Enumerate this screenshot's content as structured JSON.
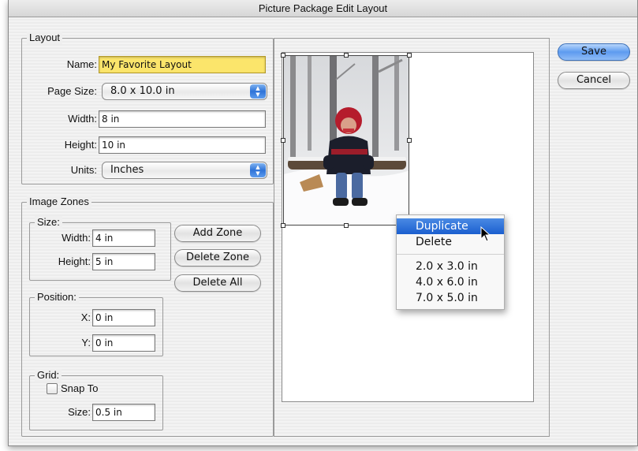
{
  "window": {
    "title": "Picture Package Edit Layout"
  },
  "layout": {
    "legend": "Layout",
    "name_label": "Name:",
    "name_value": "My Favorite Layout",
    "page_size_label": "Page Size:",
    "page_size_value": "8.0 x 10.0 in",
    "width_label": "Width:",
    "width_value": "8 in",
    "height_label": "Height:",
    "height_value": "10 in",
    "units_label": "Units:",
    "units_value": "Inches"
  },
  "image_zones": {
    "legend": "Image Zones",
    "size": {
      "legend": "Size:",
      "width_label": "Width:",
      "width_value": "4 in",
      "height_label": "Height:",
      "height_value": "5 in"
    },
    "add_zone": "Add Zone",
    "delete_zone": "Delete Zone",
    "delete_all": "Delete All",
    "position": {
      "legend": "Position:",
      "x_label": "X:",
      "x_value": "0 in",
      "y_label": "Y:",
      "y_value": "0 in"
    },
    "grid": {
      "legend": "Grid:",
      "snap_label": "Snap To",
      "snap_checked": false,
      "size_label": "Size:",
      "size_value": "0.5 in"
    }
  },
  "buttons": {
    "save": "Save",
    "cancel": "Cancel"
  },
  "context_menu": {
    "items": [
      "Duplicate",
      "Delete"
    ],
    "sizes": [
      "2.0 x 3.0 in",
      "4.0 x 6.0 in",
      "7.0 x 5.0 in"
    ],
    "selected": "Duplicate"
  },
  "icons": {
    "popup_arrows": "up-down-arrows-icon",
    "cursor": "arrow-cursor-icon",
    "photo": "photo-child-in-snow"
  },
  "colors": {
    "name_field_highlight": "#fbe56b",
    "default_button": "#5d9bf0",
    "menu_selection": "#1b5fcf"
  }
}
